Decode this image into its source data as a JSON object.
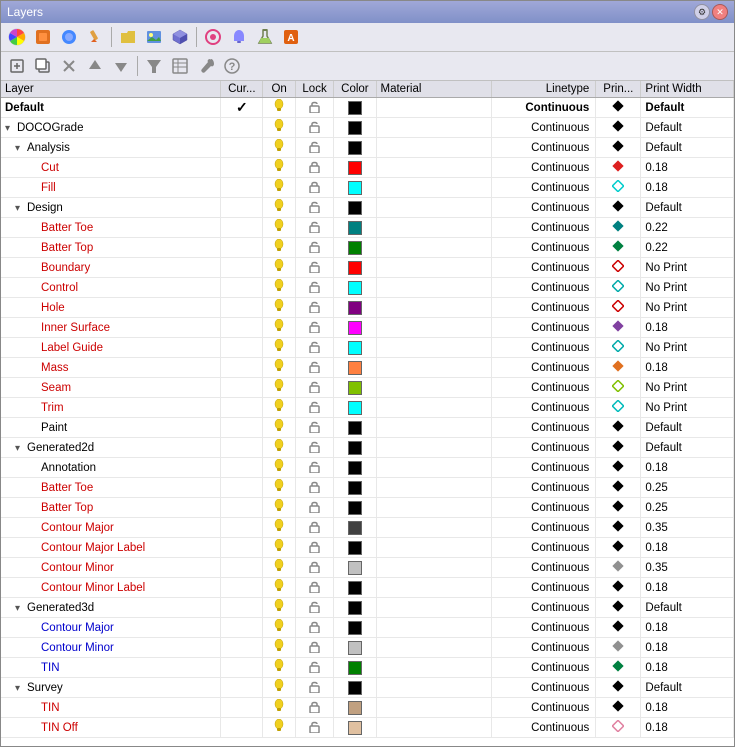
{
  "window": {
    "title": "Layers"
  },
  "toolbar1": {
    "icons": [
      {
        "name": "color-wheel-icon",
        "symbol": "🎨"
      },
      {
        "name": "layer-new-icon",
        "symbol": "🟧"
      },
      {
        "name": "layer-props-icon",
        "symbol": "🔵"
      },
      {
        "name": "eyedropper-icon",
        "symbol": "✏️"
      },
      {
        "name": "folder-open-icon",
        "symbol": "📂"
      },
      {
        "name": "image-icon",
        "symbol": "🖼"
      },
      {
        "name": "cube-icon",
        "symbol": "📦"
      },
      {
        "name": "pink-circle-icon",
        "symbol": "🔴"
      },
      {
        "name": "bell-icon",
        "symbol": "🔔"
      },
      {
        "name": "flask-icon",
        "symbol": "🧪"
      },
      {
        "name": "orange-icon",
        "symbol": "🟠"
      }
    ]
  },
  "toolbar2": {
    "icons": [
      {
        "name": "new-icon",
        "symbol": "📄"
      },
      {
        "name": "copy-icon",
        "symbol": "📋"
      },
      {
        "name": "delete-icon",
        "symbol": "✖"
      },
      {
        "name": "up-icon",
        "symbol": "▲"
      },
      {
        "name": "down-icon",
        "symbol": "▼"
      },
      {
        "name": "filter-icon",
        "symbol": "⚗"
      },
      {
        "name": "settings2-icon",
        "symbol": "📊"
      },
      {
        "name": "tool-icon",
        "symbol": "🔧"
      },
      {
        "name": "help-icon",
        "symbol": "❓"
      }
    ]
  },
  "columns": [
    "Layer",
    "Cur...",
    "On",
    "Lock",
    "Color",
    "Material",
    "Linetype",
    "Print...",
    "Print Width"
  ],
  "rows": [
    {
      "name": "Default",
      "nameClass": "layer-name-bold",
      "indent": 0,
      "current": true,
      "on": true,
      "lock": false,
      "color": "#000000",
      "material": "",
      "linetype": "Continuous",
      "linetypeBold": true,
      "printSymbol": "diamond-black",
      "printWidth": "Default",
      "pwBold": true
    },
    {
      "name": "DOCOGrade",
      "nameClass": "layer-name-black",
      "indent": 0,
      "toggle": "collapse",
      "current": false,
      "on": true,
      "lock": false,
      "color": "#000000",
      "material": "",
      "linetype": "Continuous",
      "linetypeBold": false,
      "printSymbol": "diamond-black",
      "printWidth": "Default",
      "pwBold": false
    },
    {
      "name": "Analysis",
      "nameClass": "layer-name-black",
      "indent": 1,
      "toggle": "collapse",
      "current": false,
      "on": true,
      "lock": false,
      "color": "#000000",
      "material": "",
      "linetype": "Continuous",
      "linetypeBold": false,
      "printSymbol": "diamond-black",
      "printWidth": "Default",
      "pwBold": false
    },
    {
      "name": "Cut",
      "nameClass": "layer-name",
      "indent": 2,
      "current": false,
      "on": true,
      "lock": true,
      "color": "#ff0000",
      "material": "",
      "linetype": "Continuous",
      "linetypeBold": false,
      "printSymbol": "diamond-red",
      "printWidth": "0.18",
      "pwBold": false
    },
    {
      "name": "Fill",
      "nameClass": "layer-name",
      "indent": 2,
      "current": false,
      "on": true,
      "lock": true,
      "color": "#00ffff",
      "material": "",
      "linetype": "Continuous",
      "linetypeBold": false,
      "printSymbol": "diamond-cyan",
      "printWidth": "0.18",
      "pwBold": false
    },
    {
      "name": "Design",
      "nameClass": "layer-name-black",
      "indent": 1,
      "toggle": "collapse",
      "current": false,
      "on": true,
      "lock": false,
      "color": "#000000",
      "material": "",
      "linetype": "Continuous",
      "linetypeBold": false,
      "printSymbol": "diamond-black",
      "printWidth": "Default",
      "pwBold": false
    },
    {
      "name": "Batter Toe",
      "nameClass": "layer-name",
      "indent": 2,
      "current": false,
      "on": true,
      "lock": false,
      "color": "#008080",
      "material": "",
      "linetype": "Continuous",
      "linetypeBold": false,
      "printSymbol": "diamond-teal",
      "printWidth": "0.22",
      "pwBold": false
    },
    {
      "name": "Batter Top",
      "nameClass": "layer-name",
      "indent": 2,
      "current": false,
      "on": true,
      "lock": false,
      "color": "#008000",
      "material": "",
      "linetype": "Continuous",
      "linetypeBold": false,
      "printSymbol": "diamond-green",
      "printWidth": "0.22",
      "pwBold": false
    },
    {
      "name": "Boundary",
      "nameClass": "layer-name",
      "indent": 2,
      "current": false,
      "on": true,
      "lock": false,
      "color": "#ff0000",
      "material": "",
      "linetype": "Continuous",
      "linetypeBold": false,
      "printSymbol": "noprint",
      "printWidth": "No Print",
      "pwBold": false
    },
    {
      "name": "Control",
      "nameClass": "layer-name",
      "indent": 2,
      "current": false,
      "on": true,
      "lock": false,
      "color": "#00ffff",
      "material": "",
      "linetype": "Continuous",
      "linetypeBold": false,
      "printSymbol": "noprint-cyan",
      "printWidth": "No Print",
      "pwBold": false
    },
    {
      "name": "Hole",
      "nameClass": "layer-name",
      "indent": 2,
      "current": false,
      "on": true,
      "lock": false,
      "color": "#800080",
      "material": "",
      "linetype": "Continuous",
      "linetypeBold": false,
      "printSymbol": "noprint",
      "printWidth": "No Print",
      "pwBold": false
    },
    {
      "name": "Inner Surface",
      "nameClass": "layer-name",
      "indent": 2,
      "current": false,
      "on": true,
      "lock": false,
      "color": "#ff00ff",
      "material": "",
      "linetype": "Continuous",
      "linetypeBold": false,
      "printSymbol": "diamond-purple",
      "printWidth": "0.18",
      "pwBold": false
    },
    {
      "name": "Label Guide",
      "nameClass": "layer-name",
      "indent": 2,
      "current": false,
      "on": true,
      "lock": false,
      "color": "#00ffff",
      "material": "",
      "linetype": "Continuous",
      "linetypeBold": false,
      "printSymbol": "noprint-cyan",
      "printWidth": "No Print",
      "pwBold": false
    },
    {
      "name": "Mass",
      "nameClass": "layer-name",
      "indent": 2,
      "current": false,
      "on": true,
      "lock": false,
      "color": "#ff8040",
      "material": "",
      "linetype": "Continuous",
      "linetypeBold": false,
      "printSymbol": "diamond-orange",
      "printWidth": "0.18",
      "pwBold": false
    },
    {
      "name": "Seam",
      "nameClass": "layer-name",
      "indent": 2,
      "current": false,
      "on": true,
      "lock": false,
      "color": "#80c000",
      "material": "",
      "linetype": "Continuous",
      "linetypeBold": false,
      "printSymbol": "noprint-lime",
      "printWidth": "No Print",
      "pwBold": false
    },
    {
      "name": "Trim",
      "nameClass": "layer-name",
      "indent": 2,
      "current": false,
      "on": true,
      "lock": false,
      "color": "#00ffff",
      "material": "",
      "linetype": "Continuous",
      "linetypeBold": false,
      "printSymbol": "noprint-cyan2",
      "printWidth": "No Print",
      "pwBold": false
    },
    {
      "name": "Paint",
      "nameClass": "layer-name-black",
      "indent": 2,
      "current": false,
      "on": true,
      "lock": false,
      "color": "#000000",
      "material": "",
      "linetype": "Continuous",
      "linetypeBold": false,
      "printSymbol": "diamond-black",
      "printWidth": "Default",
      "pwBold": false
    },
    {
      "name": "Generated2d",
      "nameClass": "layer-name-black",
      "indent": 1,
      "toggle": "collapse",
      "current": false,
      "on": true,
      "lock": false,
      "color": "#000000",
      "material": "",
      "linetype": "Continuous",
      "linetypeBold": false,
      "printSymbol": "diamond-black",
      "printWidth": "Default",
      "pwBold": false
    },
    {
      "name": "Annotation",
      "nameClass": "layer-name-black",
      "indent": 2,
      "current": false,
      "on": true,
      "lock": false,
      "color": "#000000",
      "material": "",
      "linetype": "Continuous",
      "linetypeBold": false,
      "printSymbol": "diamond-black",
      "printWidth": "0.18",
      "pwBold": false
    },
    {
      "name": "Batter Toe",
      "nameClass": "layer-name",
      "indent": 2,
      "current": false,
      "on": true,
      "lock": true,
      "color": "#000000",
      "material": "",
      "linetype": "Continuous",
      "linetypeBold": false,
      "printSymbol": "diamond-black",
      "printWidth": "0.25",
      "pwBold": false
    },
    {
      "name": "Batter Top",
      "nameClass": "layer-name",
      "indent": 2,
      "current": false,
      "on": true,
      "lock": true,
      "color": "#000000",
      "material": "",
      "linetype": "Continuous",
      "linetypeBold": false,
      "printSymbol": "diamond-black",
      "printWidth": "0.25",
      "pwBold": false
    },
    {
      "name": "Contour Major",
      "nameClass": "layer-name",
      "indent": 2,
      "current": false,
      "on": true,
      "lock": true,
      "color": "#404040",
      "material": "",
      "linetype": "Continuous",
      "linetypeBold": false,
      "printSymbol": "diamond-black",
      "printWidth": "0.35",
      "pwBold": false
    },
    {
      "name": "Contour Major Label",
      "nameClass": "layer-name",
      "indent": 2,
      "current": false,
      "on": true,
      "lock": true,
      "color": "#000000",
      "material": "",
      "linetype": "Continuous",
      "linetypeBold": false,
      "printSymbol": "diamond-black",
      "printWidth": "0.18",
      "pwBold": false
    },
    {
      "name": "Contour Minor",
      "nameClass": "layer-name",
      "indent": 2,
      "current": false,
      "on": true,
      "lock": true,
      "color": "#c0c0c0",
      "material": "",
      "linetype": "Continuous",
      "linetypeBold": false,
      "printSymbol": "diamond-gray",
      "printWidth": "0.35",
      "pwBold": false
    },
    {
      "name": "Contour Minor Label",
      "nameClass": "layer-name",
      "indent": 2,
      "current": false,
      "on": true,
      "lock": true,
      "color": "#000000",
      "material": "",
      "linetype": "Continuous",
      "linetypeBold": false,
      "printSymbol": "diamond-black",
      "printWidth": "0.18",
      "pwBold": false
    },
    {
      "name": "Generated3d",
      "nameClass": "layer-name-black",
      "indent": 1,
      "toggle": "collapse",
      "current": false,
      "on": true,
      "lock": false,
      "color": "#000000",
      "material": "",
      "linetype": "Continuous",
      "linetypeBold": false,
      "printSymbol": "diamond-black",
      "printWidth": "Default",
      "pwBold": false
    },
    {
      "name": "Contour Major",
      "nameClass": "layer-name-blue",
      "indent": 2,
      "current": false,
      "on": true,
      "lock": true,
      "color": "#000000",
      "material": "",
      "linetype": "Continuous",
      "linetypeBold": false,
      "printSymbol": "diamond-black",
      "printWidth": "0.18",
      "pwBold": false
    },
    {
      "name": "Contour Minor",
      "nameClass": "layer-name-blue",
      "indent": 2,
      "current": false,
      "on": true,
      "lock": true,
      "color": "#c0c0c0",
      "material": "",
      "linetype": "Continuous",
      "linetypeBold": false,
      "printSymbol": "diamond-gray",
      "printWidth": "0.18",
      "pwBold": false
    },
    {
      "name": "TIN",
      "nameClass": "layer-name-blue",
      "indent": 2,
      "current": false,
      "on": true,
      "lock": false,
      "color": "#008000",
      "material": "",
      "linetype": "Continuous",
      "linetypeBold": false,
      "printSymbol": "diamond-green",
      "printWidth": "0.18",
      "pwBold": false
    },
    {
      "name": "Survey",
      "nameClass": "layer-name-black",
      "indent": 1,
      "toggle": "collapse",
      "current": false,
      "on": true,
      "lock": false,
      "color": "#000000",
      "material": "",
      "linetype": "Continuous",
      "linetypeBold": false,
      "printSymbol": "diamond-black",
      "printWidth": "Default",
      "pwBold": false
    },
    {
      "name": "TIN",
      "nameClass": "layer-name",
      "indent": 2,
      "current": false,
      "on": true,
      "lock": true,
      "color": "#c0a080",
      "material": "",
      "linetype": "Continuous",
      "linetypeBold": false,
      "printSymbol": "diamond-black",
      "printWidth": "0.18",
      "pwBold": false
    },
    {
      "name": "TIN Off",
      "nameClass": "layer-name",
      "indent": 2,
      "current": false,
      "on": true,
      "lock": false,
      "color": "#e0c0a0",
      "material": "",
      "linetype": "Continuous",
      "linetypeBold": false,
      "printSymbol": "diamond-pink",
      "printWidth": "0.18",
      "pwBold": false
    }
  ]
}
